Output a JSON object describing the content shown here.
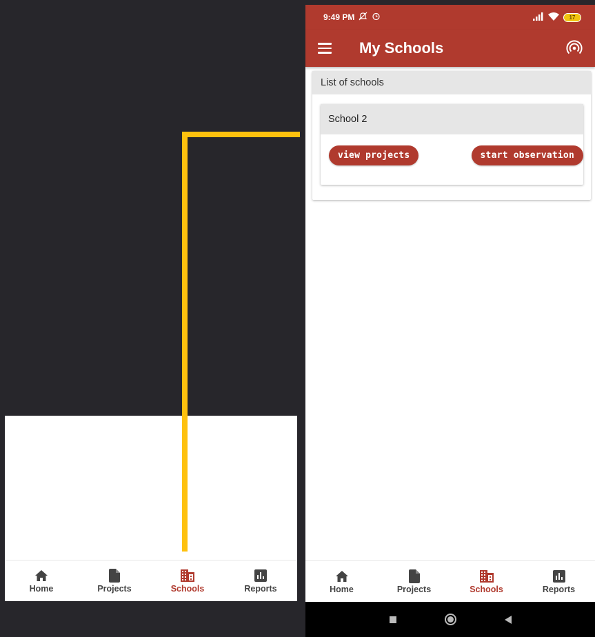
{
  "status_bar": {
    "time": "9:49 PM",
    "battery": "17"
  },
  "app_bar": {
    "title": "My Schools"
  },
  "schools_card": {
    "header": "List of schools",
    "items": [
      {
        "name": "School 2",
        "view_projects_label": "view projects",
        "start_observation_label": "start observation"
      }
    ]
  },
  "bottom_nav": {
    "items": [
      {
        "label": "Home",
        "icon": "home-icon"
      },
      {
        "label": "Projects",
        "icon": "document-icon"
      },
      {
        "label": "Schools",
        "icon": "building-icon"
      },
      {
        "label": "Reports",
        "icon": "bar-chart-icon"
      }
    ],
    "active": "Schools"
  },
  "colors": {
    "primary": "#b03a2e",
    "annotation": "#fec10e",
    "background": "#27262b"
  }
}
